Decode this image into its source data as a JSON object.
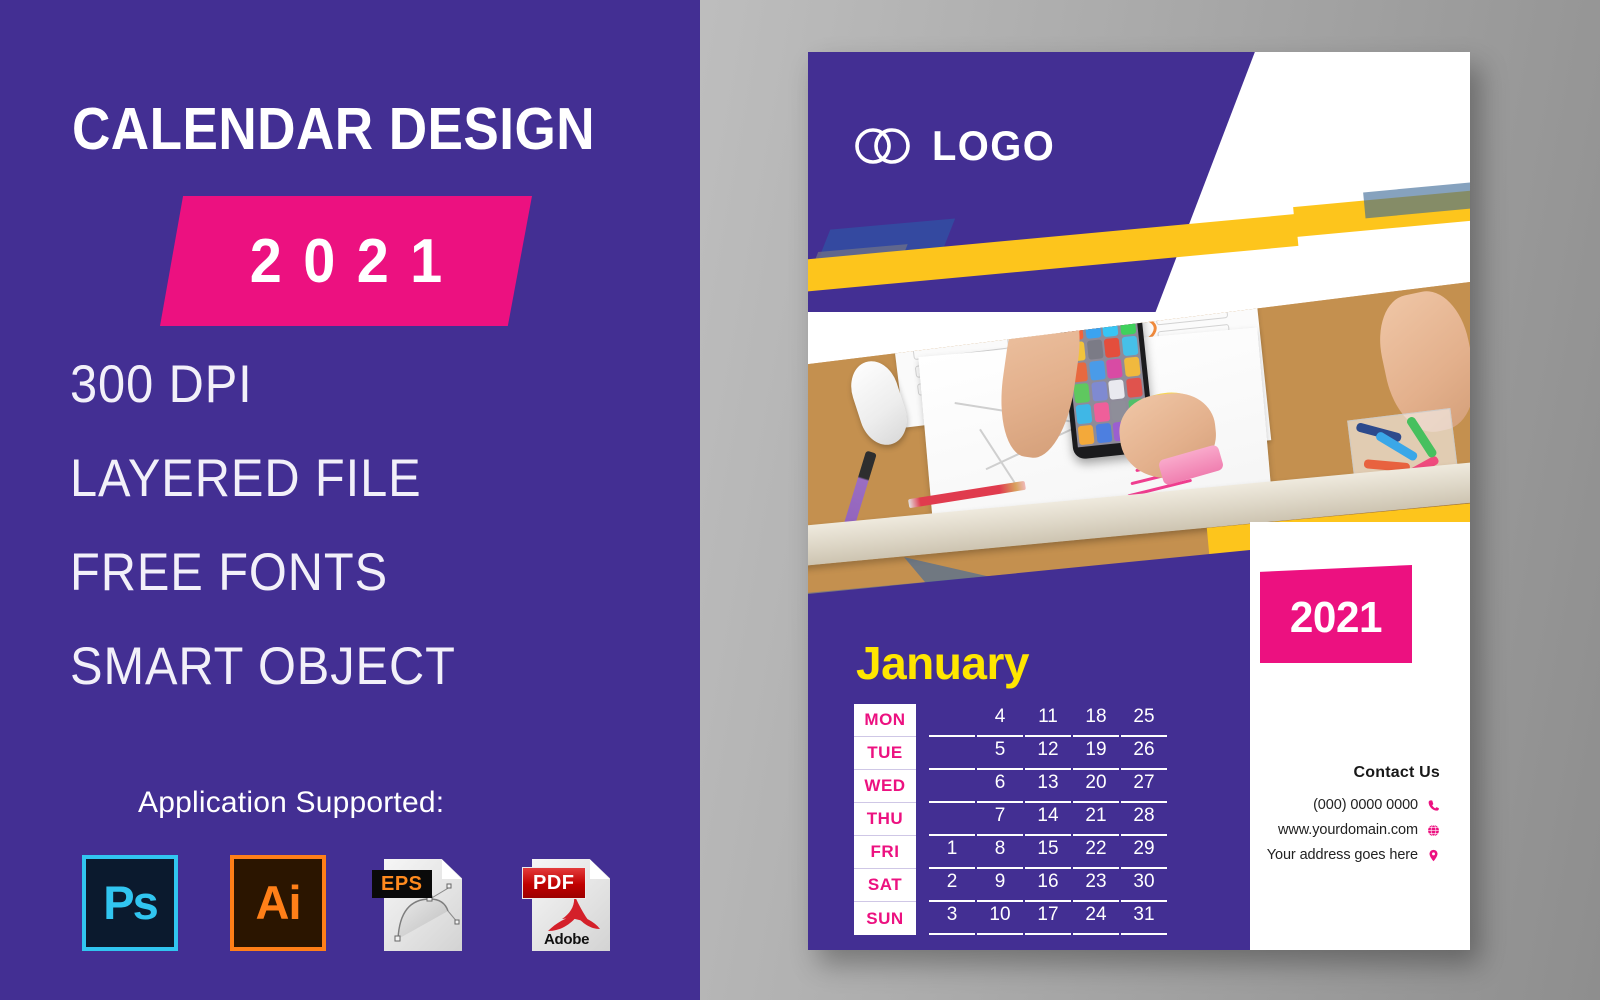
{
  "promo": {
    "title": "CALENDAR DESIGN",
    "year_banner": "2021",
    "features": [
      "300 DPI",
      "LAYERED FILE",
      "FREE FONTS",
      "SMART OBJECT"
    ],
    "apps_label": "Application Supported:",
    "apps": [
      {
        "name": "photoshop",
        "label": "Ps"
      },
      {
        "name": "illustrator",
        "label": "Ai"
      },
      {
        "name": "eps",
        "label": "EPS"
      },
      {
        "name": "pdf",
        "label": "PDF",
        "sub": "Adobe"
      }
    ]
  },
  "poster": {
    "logo_text": "LOGO",
    "year_badge": "2021",
    "month": "January",
    "calendar": {
      "day_labels": [
        "MON",
        "TUE",
        "WED",
        "THU",
        "FRI",
        "SAT",
        "SUN"
      ],
      "weeks": [
        [
          "",
          "4",
          "11",
          "18",
          "25"
        ],
        [
          "",
          "5",
          "12",
          "19",
          "26"
        ],
        [
          "",
          "6",
          "13",
          "20",
          "27"
        ],
        [
          "",
          "7",
          "14",
          "21",
          "28"
        ],
        [
          "1",
          "8",
          "15",
          "22",
          "29"
        ],
        [
          "2",
          "9",
          "16",
          "23",
          "30"
        ],
        [
          "3",
          "10",
          "17",
          "24",
          "31"
        ]
      ]
    },
    "contact": {
      "title": "Contact Us",
      "phone": "(000) 0000 0000",
      "website": "www.yourdomain.com",
      "address": "Your address goes here"
    }
  },
  "colors": {
    "purple": "#432f93",
    "pink": "#ec1180",
    "yellow": "#fdc51c",
    "month_yellow": "#ffe600",
    "white": "#ffffff",
    "background_gray": "#bdbdbd"
  }
}
